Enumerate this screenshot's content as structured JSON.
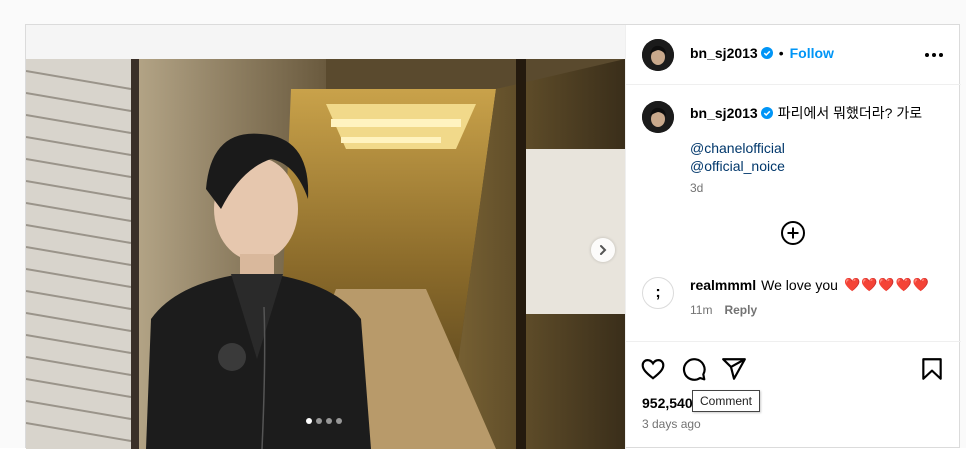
{
  "post": {
    "username": "bn_sj2013",
    "follow_label": "Follow",
    "separator": "•",
    "caption": "파리에서 뭐했더라? 가로",
    "mentions": [
      "@chanelofficial",
      "@official_noice"
    ],
    "caption_age": "3d"
  },
  "comment": {
    "avatar_glyph": ";",
    "username": "realmmml",
    "text": "We love you",
    "hearts": "❤️❤️❤️❤️❤️",
    "age": "11m",
    "reply_label": "Reply"
  },
  "stats": {
    "likes": "952,540",
    "date": "3 days ago"
  },
  "tooltip": {
    "text": "Comment"
  },
  "carousel": {
    "total": 4,
    "active_index": 0
  },
  "colors": {
    "accent": "#0095f6",
    "heart": "#e0245e",
    "verified": "#0095f6"
  },
  "icons": {
    "more": "more-horizontal-icon",
    "like": "heart-icon",
    "comment": "comment-icon",
    "share": "share-icon",
    "save": "bookmark-icon",
    "add": "plus-circle-icon",
    "next": "chevron-right-icon",
    "verified": "verified-badge-icon"
  }
}
